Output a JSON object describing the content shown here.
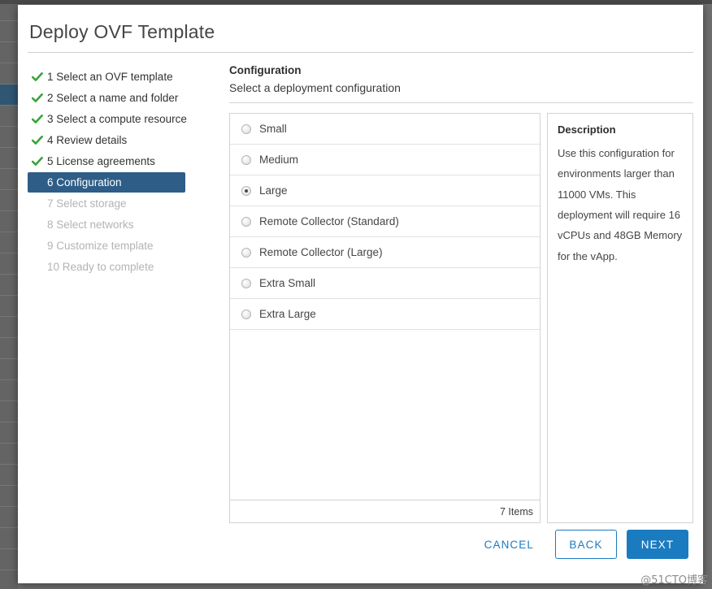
{
  "dialog": {
    "title": "Deploy OVF Template"
  },
  "wizard": {
    "steps": [
      {
        "number": "1",
        "label": "1 Select an OVF template",
        "state": "done"
      },
      {
        "number": "2",
        "label": "2 Select a name and folder",
        "state": "done"
      },
      {
        "number": "3",
        "label": "3 Select a compute resource",
        "state": "done"
      },
      {
        "number": "4",
        "label": "4 Review details",
        "state": "done"
      },
      {
        "number": "5",
        "label": "5 License agreements",
        "state": "done"
      },
      {
        "number": "6",
        "label": "6 Configuration",
        "state": "current"
      },
      {
        "number": "7",
        "label": "7 Select storage",
        "state": "pending"
      },
      {
        "number": "8",
        "label": "8 Select networks",
        "state": "pending"
      },
      {
        "number": "9",
        "label": "9 Customize template",
        "state": "pending"
      },
      {
        "number": "10",
        "label": "10 Ready to complete",
        "state": "pending"
      }
    ]
  },
  "content": {
    "title": "Configuration",
    "subtitle": "Select a deployment configuration"
  },
  "options": {
    "items": [
      {
        "label": "Small",
        "selected": false
      },
      {
        "label": "Medium",
        "selected": false
      },
      {
        "label": "Large",
        "selected": true
      },
      {
        "label": "Remote Collector (Standard)",
        "selected": false
      },
      {
        "label": "Remote Collector (Large)",
        "selected": false
      },
      {
        "label": "Extra Small",
        "selected": false
      },
      {
        "label": "Extra Large",
        "selected": false
      }
    ],
    "footer_count": "7 Items"
  },
  "description": {
    "heading": "Description",
    "text": "Use this configuration for environments larger than 11000 VMs. This deployment will require 16 vCPUs and 48GB Memory for the vApp."
  },
  "footer": {
    "cancel_label": "CANCEL",
    "back_label": "BACK",
    "next_label": "NEXT"
  },
  "watermark": "@51CTO博客",
  "colors": {
    "accent_blue": "#1a7bc0",
    "nav_current_bg": "#2e5d87",
    "check_green": "#3aa33a"
  }
}
